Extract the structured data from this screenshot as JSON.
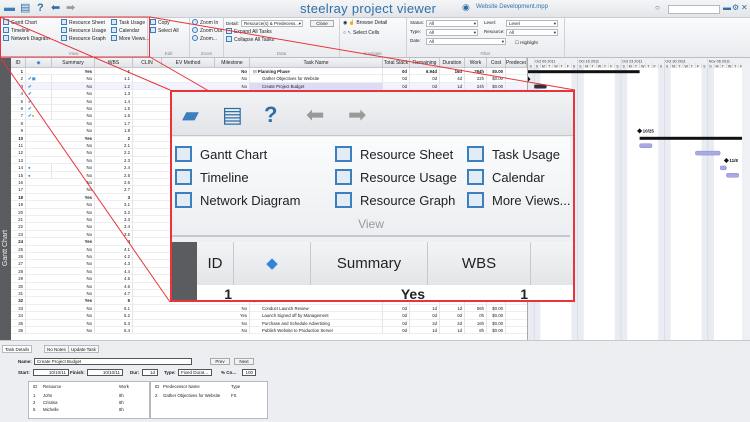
{
  "titlebar": {
    "app_title": "steelray project viewer",
    "file_name": "Website Development.mpp",
    "search_placeholder": "",
    "icons": [
      "folder-icon",
      "print-icon",
      "help-icon",
      "back-arrow-icon",
      "forward-arrow-icon"
    ]
  },
  "ribbon": {
    "view": {
      "label": "View",
      "items": [
        "Gantt Chart",
        "Timeline",
        "Network Diagram",
        "Resource Sheet",
        "Resource Usage",
        "Resource Graph",
        "Task Usage",
        "Calendar",
        "More Views..."
      ]
    },
    "edit": {
      "label": "Edit",
      "items": [
        "Copy",
        "Select All"
      ]
    },
    "zoom": {
      "label": "Zoom",
      "items": [
        "Zoom In",
        "Zoom Out",
        "Zoom..."
      ]
    },
    "data": {
      "label": "Data",
      "detail_label": "Detail:",
      "detail_value": "Resource(s) & Predecess...",
      "close": "Close",
      "expand": "Expand All Tasks",
      "collapse": "Collapse All Tasks"
    },
    "navigate": {
      "label": "Navigate",
      "browse": "Browse Detail",
      "select": "Select Cells",
      "selected": "Browse Detail"
    },
    "filter": {
      "label": "Filter",
      "status_label": "Status:",
      "status": "All",
      "type_label": "Type:",
      "type": "All",
      "date_label": "Date:",
      "date": "All",
      "level_label": "Level:",
      "level": "Level",
      "resource_label": "Resource:",
      "resource": "All",
      "highlight": "Highlight",
      "highlight_checked": false
    }
  },
  "side_label": "Gantt Chart",
  "columns": [
    "ID",
    "",
    "Summary",
    "WBS",
    "CLIN",
    "EV Method",
    "Milestone",
    "Task Name",
    "Total Slack",
    "Remaining",
    "Duration",
    "Work",
    "Cost",
    "Predeces"
  ],
  "rows": [
    [
      "1",
      "Yes",
      "1",
      "No",
      "Planning Phase",
      "0d",
      "6.94d",
      "16d",
      "284h",
      "$0.00"
    ],
    [
      "2",
      "No",
      "1.1",
      "No",
      "Gather Objectives for Website",
      "0d",
      "0d",
      "4d",
      "22h",
      "$0.00"
    ],
    [
      "3",
      "No",
      "1.2",
      "No",
      "Create Project Budget",
      "0d",
      "0d",
      "1d",
      "24h",
      "$0.00"
    ],
    [
      "4",
      "No",
      "1.3"
    ],
    [
      "5",
      "No",
      "1.4"
    ],
    [
      "6",
      "No",
      "1.5"
    ],
    [
      "7",
      "No",
      "1.6"
    ],
    [
      "8",
      "No",
      "1.7"
    ],
    [
      "9",
      "No",
      "1.8"
    ],
    [
      "10",
      "Yes",
      "2"
    ],
    [
      "11",
      "No",
      "2.1"
    ],
    [
      "12",
      "No",
      "2.2"
    ],
    [
      "13",
      "No",
      "2.3"
    ],
    [
      "14",
      "No",
      "2.4"
    ],
    [
      "15",
      "No",
      "2.5"
    ],
    [
      "16",
      "No",
      "2.6"
    ],
    [
      "17",
      "No",
      "2.7"
    ],
    [
      "18",
      "Yes",
      "3"
    ],
    [
      "19",
      "No",
      "3.1"
    ],
    [
      "20",
      "No",
      "3.2"
    ],
    [
      "21",
      "No",
      "3.3"
    ],
    [
      "22",
      "No",
      "3.4"
    ],
    [
      "23",
      "No",
      "3.5"
    ],
    [
      "24",
      "Yes",
      "4"
    ],
    [
      "25",
      "No",
      "4.1"
    ],
    [
      "26",
      "No",
      "4.2"
    ],
    [
      "27",
      "No",
      "4.3"
    ],
    [
      "28",
      "No",
      "4.4"
    ],
    [
      "29",
      "No",
      "4.5"
    ],
    [
      "30",
      "No",
      "4.6"
    ],
    [
      "31",
      "No",
      "4.7"
    ],
    [
      "32",
      "Yes",
      "5",
      "No",
      "Launch",
      "0d",
      "3d",
      "3d",
      "104h",
      "$0.00"
    ],
    [
      "33",
      "No",
      "5.1",
      "No",
      "Conduct Launch Review",
      "0d",
      "1d",
      "1d",
      "56h",
      "$0.00"
    ],
    [
      "34",
      "No",
      "5.2",
      "Yes",
      "Launch Signed off by Management",
      "0d",
      "0d",
      "0d",
      "0h",
      "$0.00"
    ],
    [
      "35",
      "No",
      "5.3",
      "No",
      "Purchase and Schedule Advertising",
      "0d",
      "2d",
      "2d",
      "16h",
      "$0.00"
    ],
    [
      "36",
      "No",
      "5.4",
      "No",
      "Publish Website to Production Server",
      "0d",
      "1d",
      "1d",
      "8h",
      "$0.00"
    ]
  ],
  "row_indicators": {
    "2": "check-note",
    "3": "check",
    "4": "check",
    "5": "check",
    "6": "check",
    "7": "check-person",
    "14": "info-globe",
    "15": "info-globe"
  },
  "selected_row": "3",
  "gantt": {
    "weeks": [
      "Oct 09 2011",
      "Oct 16 2011",
      "Oct 23 2011",
      "Oct 30 2011",
      "Nov 06 2011"
    ],
    "day_letters": [
      "S",
      "S",
      "M",
      "T",
      "W",
      "T",
      "F"
    ],
    "bars": [
      {
        "row": 1,
        "type": "summary",
        "start": "2011-10-07",
        "end": "2011-10-25"
      },
      {
        "row": 2,
        "type": "milestone",
        "start": "2011-10-07"
      },
      {
        "row": 3,
        "type": "task-dark",
        "start": "2011-10-09",
        "end": "2011-10-10"
      },
      {
        "row": 9,
        "type": "milestone",
        "start": "2011-10-25",
        "label": "10/25"
      },
      {
        "row": 10,
        "type": "summary",
        "start": "2011-10-26",
        "end": "2011-11-12"
      },
      {
        "row": 11,
        "type": "task",
        "start": "2011-10-26",
        "end": "2011-10-27"
      },
      {
        "row": 12,
        "type": "task",
        "start": "2011-11-04",
        "end": "2011-11-07"
      },
      {
        "row": 13,
        "type": "milestone",
        "start": "2011-11-08",
        "label": "11/8"
      },
      {
        "row": 14,
        "type": "task",
        "start": "2011-11-08",
        "end": "2011-11-08"
      },
      {
        "row": 15,
        "type": "task",
        "start": "2011-11-09",
        "end": "2011-11-10"
      }
    ],
    "task_color": "#aaa8e6"
  },
  "details": {
    "tabs": [
      "Task Details",
      "No Notes",
      "Update Task"
    ],
    "name_label": "Name:",
    "name": "Create Project Budget",
    "prev": "Prev",
    "next": "Next",
    "start_label": "Start:",
    "start": "10/10/11",
    "finish_label": "Finish:",
    "finish": "10/10/11",
    "dur_label": "Dur:",
    "dur": "1d",
    "type_label": "Type:",
    "type": "Fixed Durat...",
    "pct_label": "% Co...",
    "pct": "100",
    "resources": {
      "headers": [
        "ID",
        "Resource",
        "Work"
      ],
      "rows": [
        [
          "1",
          "John",
          "8h"
        ],
        [
          "2",
          "Cristina",
          "8h"
        ],
        [
          "5",
          "Michelle",
          "8h"
        ]
      ]
    },
    "predecessors": {
      "headers": [
        "ID",
        "Predecessor Name",
        "Type"
      ],
      "rows": [
        [
          "2",
          "Gather Objectives for Website",
          "FS"
        ]
      ]
    }
  },
  "callout": {
    "view_label": "View",
    "headers": [
      "ID",
      "",
      "Summary",
      "WBS"
    ],
    "row": [
      "1",
      "",
      "Yes",
      "1"
    ],
    "border_color": "#e8343a"
  }
}
